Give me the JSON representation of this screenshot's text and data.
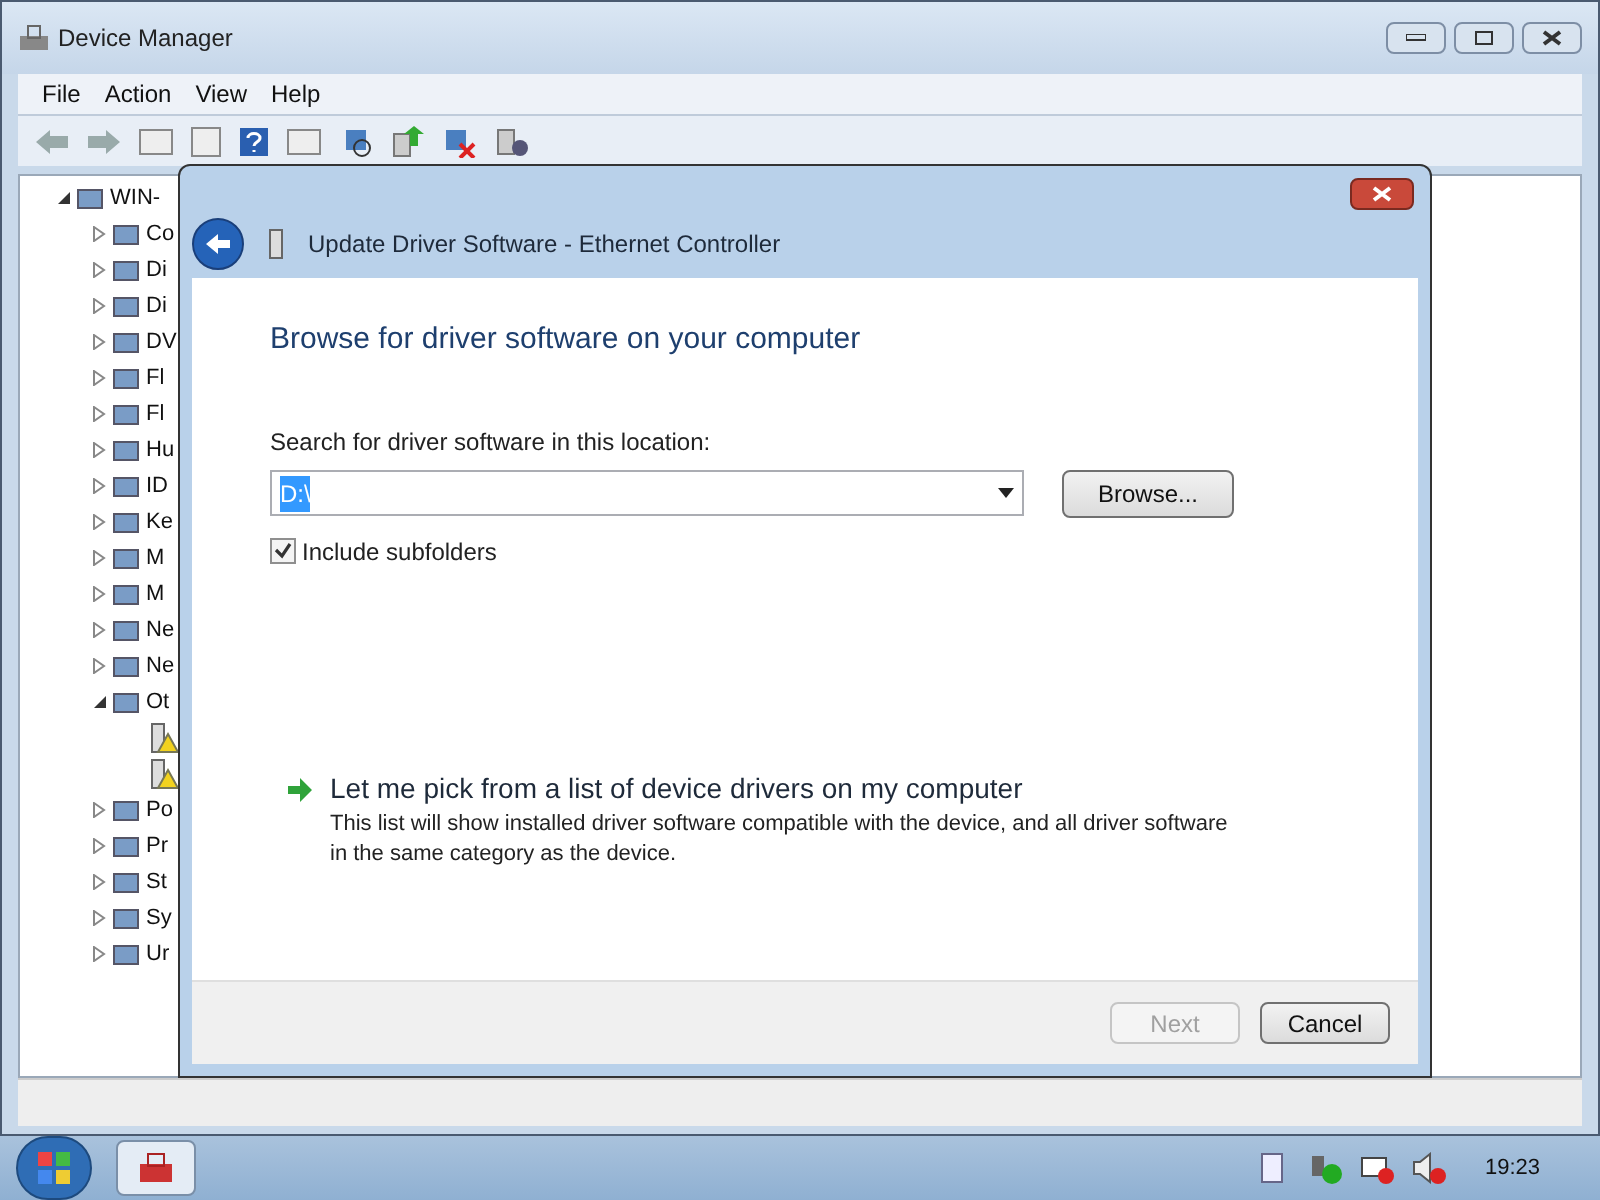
{
  "window": {
    "title": "Device Manager"
  },
  "menu": [
    {
      "label": "File"
    },
    {
      "label": "Action"
    },
    {
      "label": "View"
    },
    {
      "label": "Help"
    }
  ],
  "tree": {
    "label": "WIN-",
    "expanded": true,
    "children": [
      {
        "label": "Co",
        "expanded": false
      },
      {
        "label": "Di",
        "expanded": false
      },
      {
        "label": "Di",
        "expanded": false
      },
      {
        "label": "DV",
        "expanded": false
      },
      {
        "label": "Fl",
        "expanded": false
      },
      {
        "label": "Fl",
        "expanded": false
      },
      {
        "label": "Hu",
        "expanded": false
      },
      {
        "label": "ID",
        "expanded": false
      },
      {
        "label": "Ke",
        "expanded": false
      },
      {
        "label": "M",
        "expanded": false
      },
      {
        "label": "M",
        "expanded": false
      },
      {
        "label": "Ne",
        "expanded": false
      },
      {
        "label": "Ne",
        "expanded": false
      },
      {
        "label": "Ot",
        "expanded": true,
        "children": [
          {
            "warning": true
          },
          {
            "warning": true
          }
        ]
      },
      {
        "label": "Po",
        "expanded": false
      },
      {
        "label": "Pr",
        "expanded": false
      },
      {
        "label": "St",
        "expanded": false
      },
      {
        "label": "Sy",
        "expanded": false
      },
      {
        "label": "Ur",
        "expanded": false
      }
    ]
  },
  "dialog": {
    "title": "Update Driver Software - Ethernet Controller",
    "heading": "Browse for driver software on your computer",
    "location_label": "Search for driver software in this location:",
    "location": {
      "value": "D:\\",
      "selected": true
    },
    "browse_button": "Browse...",
    "include_subfolders": {
      "label": "Include subfolders",
      "checked": true
    },
    "pick_link": "Let me pick from a list of device drivers on my computer",
    "pick_description": "This list will show installed driver software compatible with the device, and all driver software in the same category as the device.",
    "buttons": [
      {
        "label": "Next",
        "disabled": true
      },
      {
        "label": "Cancel",
        "disabled": false
      }
    ]
  },
  "taskbar": {
    "clock": "19:23"
  }
}
